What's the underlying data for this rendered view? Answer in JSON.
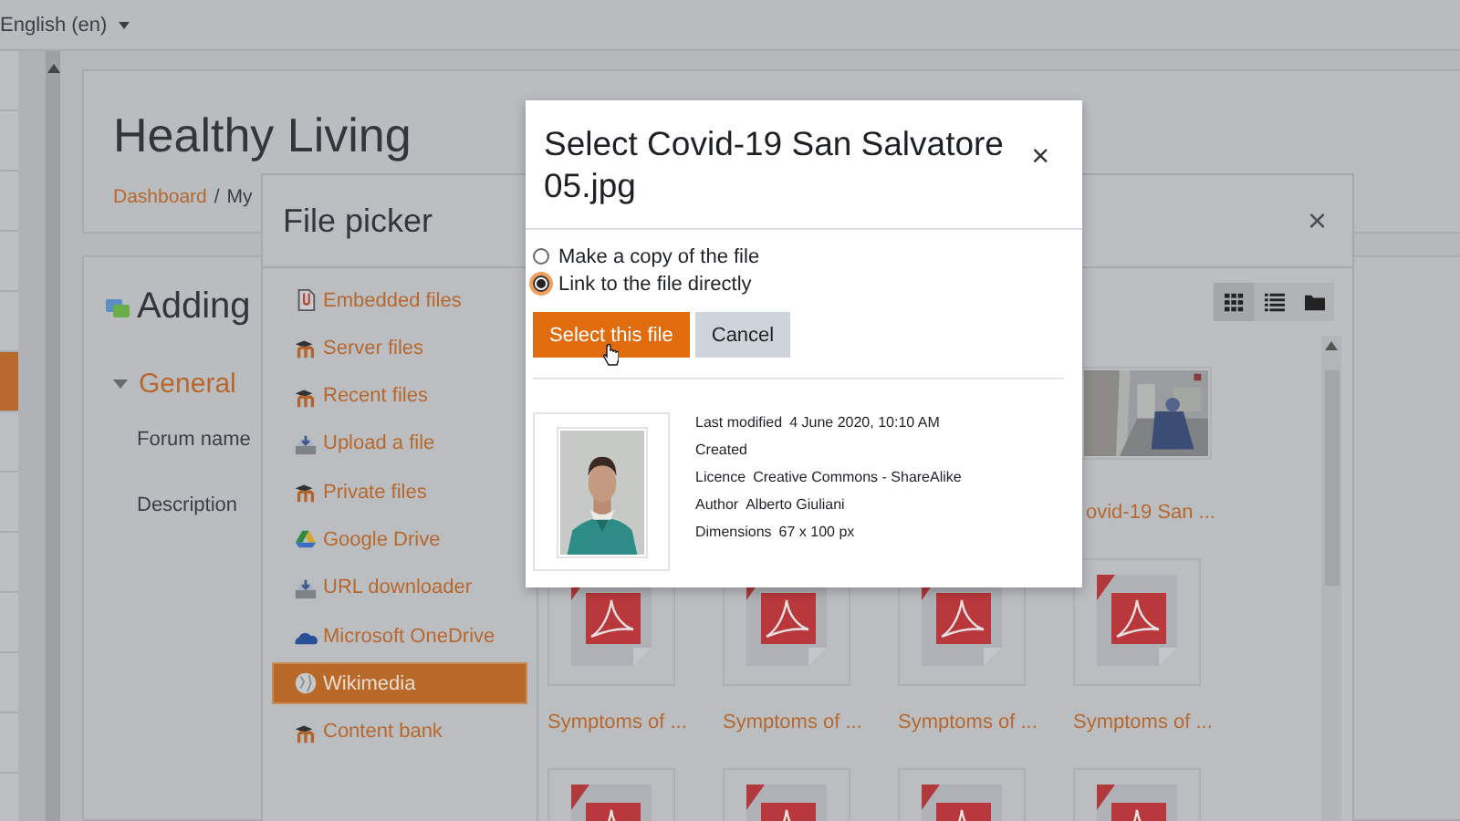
{
  "language_menu": {
    "label": "English (en)"
  },
  "drawer": {
    "items": [
      {
        "selected": false
      },
      {
        "selected": false
      },
      {
        "selected": false
      },
      {
        "selected": false
      },
      {
        "selected": false
      },
      {
        "selected": true
      },
      {
        "selected": false
      },
      {
        "selected": false
      },
      {
        "selected": false
      },
      {
        "selected": false
      },
      {
        "selected": false
      },
      {
        "selected": false
      }
    ]
  },
  "page": {
    "title": "Healthy Living",
    "breadcrumb": [
      {
        "label": "Dashboard"
      },
      {
        "label": "My"
      }
    ],
    "breadcrumb_separator": "/"
  },
  "form": {
    "heading": "Adding",
    "section": {
      "label": "General",
      "expanded": true
    },
    "fields": [
      {
        "label": "Forum name"
      },
      {
        "label": "Description"
      }
    ]
  },
  "file_picker": {
    "title": "File picker",
    "close": "×",
    "repositories": [
      {
        "label": "Embedded files",
        "kind": "embedded",
        "selected": false
      },
      {
        "label": "Server files",
        "kind": "cap",
        "selected": false
      },
      {
        "label": "Recent files",
        "kind": "cap",
        "selected": false
      },
      {
        "label": "Upload a file",
        "kind": "upload",
        "selected": false
      },
      {
        "label": "Private files",
        "kind": "cap",
        "selected": false
      },
      {
        "label": "Google Drive",
        "kind": "drive",
        "selected": false
      },
      {
        "label": "URL downloader",
        "kind": "upload",
        "selected": false
      },
      {
        "label": "Microsoft OneDrive",
        "kind": "cloud",
        "selected": false
      },
      {
        "label": "Wikimedia",
        "kind": "globe",
        "selected": true
      },
      {
        "label": "Content bank",
        "kind": "cap",
        "selected": false
      }
    ],
    "views": [
      {
        "kind": "icons",
        "selected": true
      },
      {
        "kind": "list",
        "selected": false
      },
      {
        "kind": "tree",
        "selected": false
      }
    ],
    "files": [
      {
        "label": "ovid-19 San ..."
      },
      {
        "kind": "pdf",
        "label": "Symptoms of ..."
      },
      {
        "kind": "pdf",
        "label": "Symptoms of ..."
      },
      {
        "kind": "pdf",
        "label": "Symptoms of ..."
      },
      {
        "kind": "pdf",
        "label": "Symptoms of ..."
      },
      {
        "kind": "pdf"
      },
      {
        "kind": "pdf"
      },
      {
        "kind": "pdf"
      },
      {
        "kind": "pdf"
      }
    ]
  },
  "dialog": {
    "title": "Select Covid-19 San Salvatore 05.jpg",
    "close": "×",
    "options": [
      {
        "label": "Make a copy of the file",
        "selected": false
      },
      {
        "label": "Link to the file directly",
        "selected": true
      }
    ],
    "buttons": [
      {
        "label": "Select this file",
        "kind": "primary"
      },
      {
        "label": "Cancel",
        "kind": "secondary"
      }
    ],
    "details": [
      {
        "label": "Last modified",
        "value": "4 June 2020, 10:10 AM"
      },
      {
        "label": "Created"
      },
      {
        "label": "Licence",
        "value": "Creative Commons - ShareAlike"
      },
      {
        "label": "Author",
        "value": "Alberto Giuliani"
      },
      {
        "label": "Dimensions",
        "value": "67 x 100 px"
      }
    ]
  }
}
